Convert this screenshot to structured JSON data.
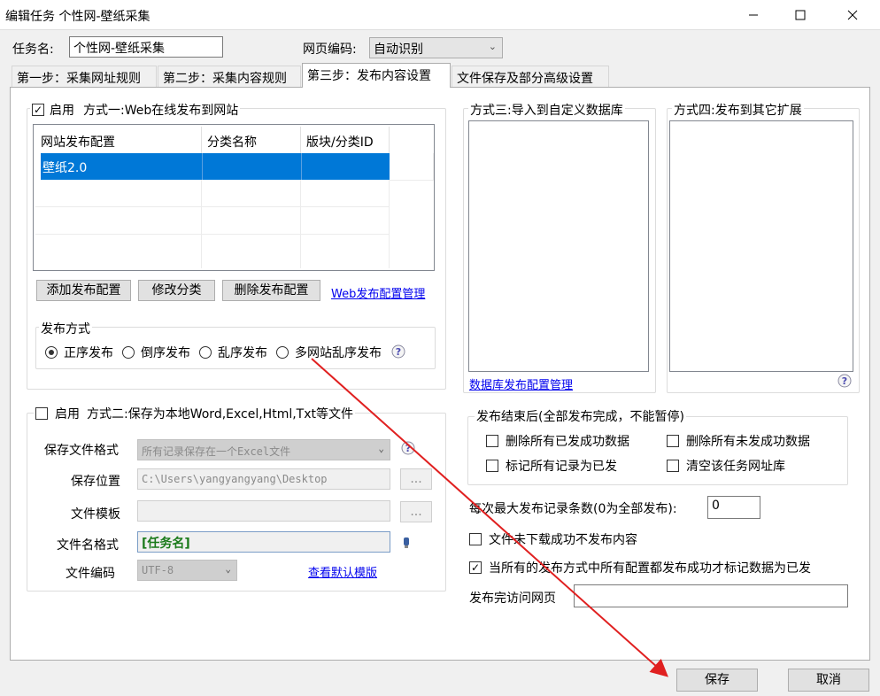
{
  "window": {
    "title": "编辑任务 个性网-壁纸采集"
  },
  "task": {
    "name_label": "任务名:",
    "name_value": "个性网-壁纸采集",
    "encoding_label": "网页编码:",
    "encoding_value": "自动识别"
  },
  "tabs": [
    {
      "label": "第一步：采集网址规则"
    },
    {
      "label": "第二步：采集内容规则"
    },
    {
      "label": "第三步：发布内容设置"
    },
    {
      "label": "文件保存及部分高级设置"
    }
  ],
  "method1": {
    "enable_label": "启用",
    "title": "方式一:Web在线发布到网站",
    "columns": [
      "网站发布配置",
      "分类名称",
      "版块/分类ID"
    ],
    "rows": [
      [
        "壁纸2.0",
        "",
        ""
      ]
    ],
    "buttons": {
      "add": "添加发布配置",
      "edit": "修改分类",
      "delete": "删除发布配置"
    },
    "manage_link": "Web发布配置管理",
    "publish_mode": {
      "title": "发布方式",
      "options": [
        "正序发布",
        "倒序发布",
        "乱序发布",
        "多网站乱序发布"
      ],
      "selected": "正序发布"
    }
  },
  "method2": {
    "enable_label": "启用",
    "title": "方式二:保存为本地Word,Excel,Html,Txt等文件",
    "format_label": "保存文件格式",
    "format_value": "所有记录保存在一个Excel文件",
    "location_label": "保存位置",
    "location_value": "C:\\Users\\yangyangyang\\Desktop",
    "browse": "...",
    "template_label": "文件模板",
    "template_value": "",
    "filename_label": "文件名格式",
    "filename_value": "[任务名]",
    "encoding_label": "文件编码",
    "encoding_value": "UTF-8",
    "default_template_link": "查看默认模版"
  },
  "method3": {
    "title": "方式三:导入到自定义数据库",
    "manage_link": "数据库发布配置管理"
  },
  "method4": {
    "title": "方式四:发布到其它扩展"
  },
  "after_publish": {
    "title": "发布结束后(全部发布完成，不能暂停)",
    "options": [
      "删除所有已发成功数据",
      "删除所有未发成功数据",
      "标记所有记录为已发",
      "清空该任务网址库"
    ]
  },
  "settings": {
    "max_label": "每次最大发布记录条数(0为全部发布):",
    "max_value": "0",
    "no_publish_failed": "文件未下载成功不发布内容",
    "mark_when_all": "当所有的发布方式中所有配置都发布成功才标记数据为已发",
    "visit_label": "发布完访问网页",
    "visit_value": ""
  },
  "footer": {
    "save": "保存",
    "cancel": "取消"
  },
  "colors": {
    "selection": "#0078d7",
    "link": "#0000ee",
    "arrow": "#e02020",
    "filename_text": "#1a7a1a"
  }
}
